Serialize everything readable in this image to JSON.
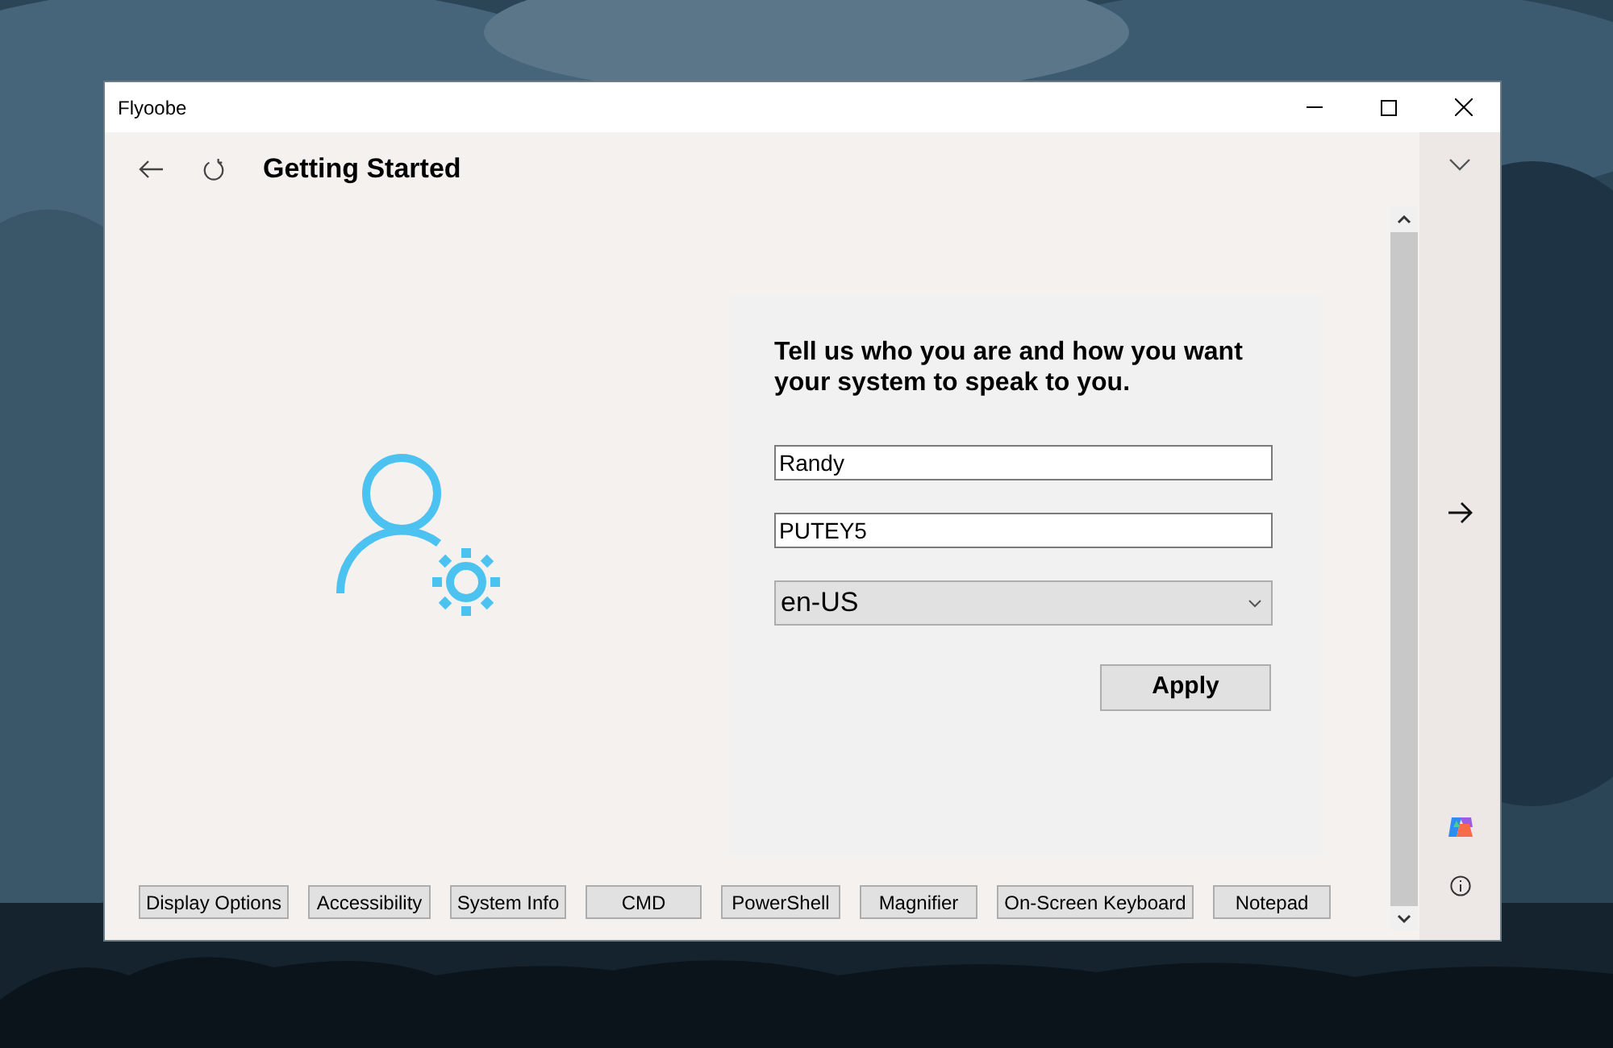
{
  "window": {
    "title": "Flyoobe"
  },
  "header": {
    "title": "Getting Started"
  },
  "form": {
    "prompt": "Tell us who you are and how you want your system to speak to you.",
    "fields": [
      {
        "kind": "text",
        "value": "Randy"
      },
      {
        "kind": "text",
        "value": "PUTEY5"
      },
      {
        "kind": "select",
        "value": "en-US"
      }
    ],
    "apply": "Apply"
  },
  "tools": [
    "Display Options",
    "Accessibility",
    "System Info",
    "CMD",
    "PowerShell",
    "Magnifier",
    "On-Screen Keyboard",
    "Notepad"
  ]
}
